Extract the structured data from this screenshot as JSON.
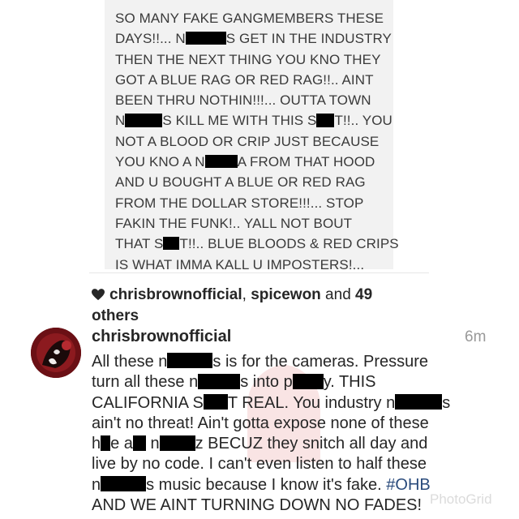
{
  "post": {
    "lines": [
      [
        "SO MANY FAKE GANGMEMBERS THESE"
      ],
      [
        "DAYS!!... N",
        {
          "w": 50
        },
        "S GET IN THE INDUSTRY"
      ],
      [
        "THEN THE NEXT THING YOU KNO THEY"
      ],
      [
        "GOT A BLUE RAG OR RED RAG!!.. AINT"
      ],
      [
        "BEEN THRU NOTHIN!!!... OUTTA TOWN"
      ],
      [
        "N",
        {
          "w": 46
        },
        "S KILL ME WITH THIS S",
        {
          "w": 22
        },
        "T!!.. YOU"
      ],
      [
        "NOT A BLOOD OR CRIP JUST BECAUSE"
      ],
      [
        "YOU KNO A N",
        {
          "w": 40
        },
        "A FROM THAT HOOD"
      ],
      [
        "AND U BOUGHT A BLUE OR RED RAG"
      ],
      [
        "FROM THE DOLLAR STORE!!!... STOP"
      ],
      [
        "FAKIN THE FUNK!.. YALL NOT BOUT"
      ],
      [
        "THAT S",
        {
          "w": 20
        },
        "T!!.. BLUE BLOODS & RED CRIPS"
      ],
      [
        "IS WHAT IMMA KALL U IMPOSTERS!..."
      ]
    ]
  },
  "likes": {
    "user1": "chrisbrownofficial",
    "sep": ", ",
    "user2": "spicewon",
    "mid": " and ",
    "count": "49",
    "line2": "others"
  },
  "comment": {
    "username": "chrisbrownofficial",
    "timestamp": "6m",
    "lines": [
      [
        "All these n",
        {
          "w": 56
        },
        "s is for the cameras. Pressure"
      ],
      [
        "turn all these n",
        {
          "w": 52
        },
        "s into p",
        {
          "w": 38
        },
        "y. THIS"
      ],
      [
        "CALIFORNIA S",
        {
          "w": 30
        },
        "T REAL. You industry n",
        {
          "w": 58
        },
        "s"
      ],
      [
        "ain't no threat! Ain't gotta expose none of these"
      ],
      [
        "h",
        {
          "w": 12
        },
        "e a",
        {
          "w": 16
        },
        " n",
        {
          "w": 44
        },
        "z BECUZ they snitch all day and"
      ],
      [
        "live by no code. I can't even listen to half these"
      ],
      [
        "n",
        {
          "w": 56
        },
        "s music because I know it's fake. ",
        {
          "tag": "#OHB"
        }
      ],
      [
        "AND WE AINT TURNING DOWN NO FADES!"
      ]
    ]
  },
  "icons": {
    "likes": "heart-icon",
    "avatar": "avatar-image"
  },
  "colors": {
    "hashtag": "#2a4b7c",
    "postBg": "#f2f2f2",
    "redaction": "#000000"
  },
  "watermark": "PhotoGrid"
}
